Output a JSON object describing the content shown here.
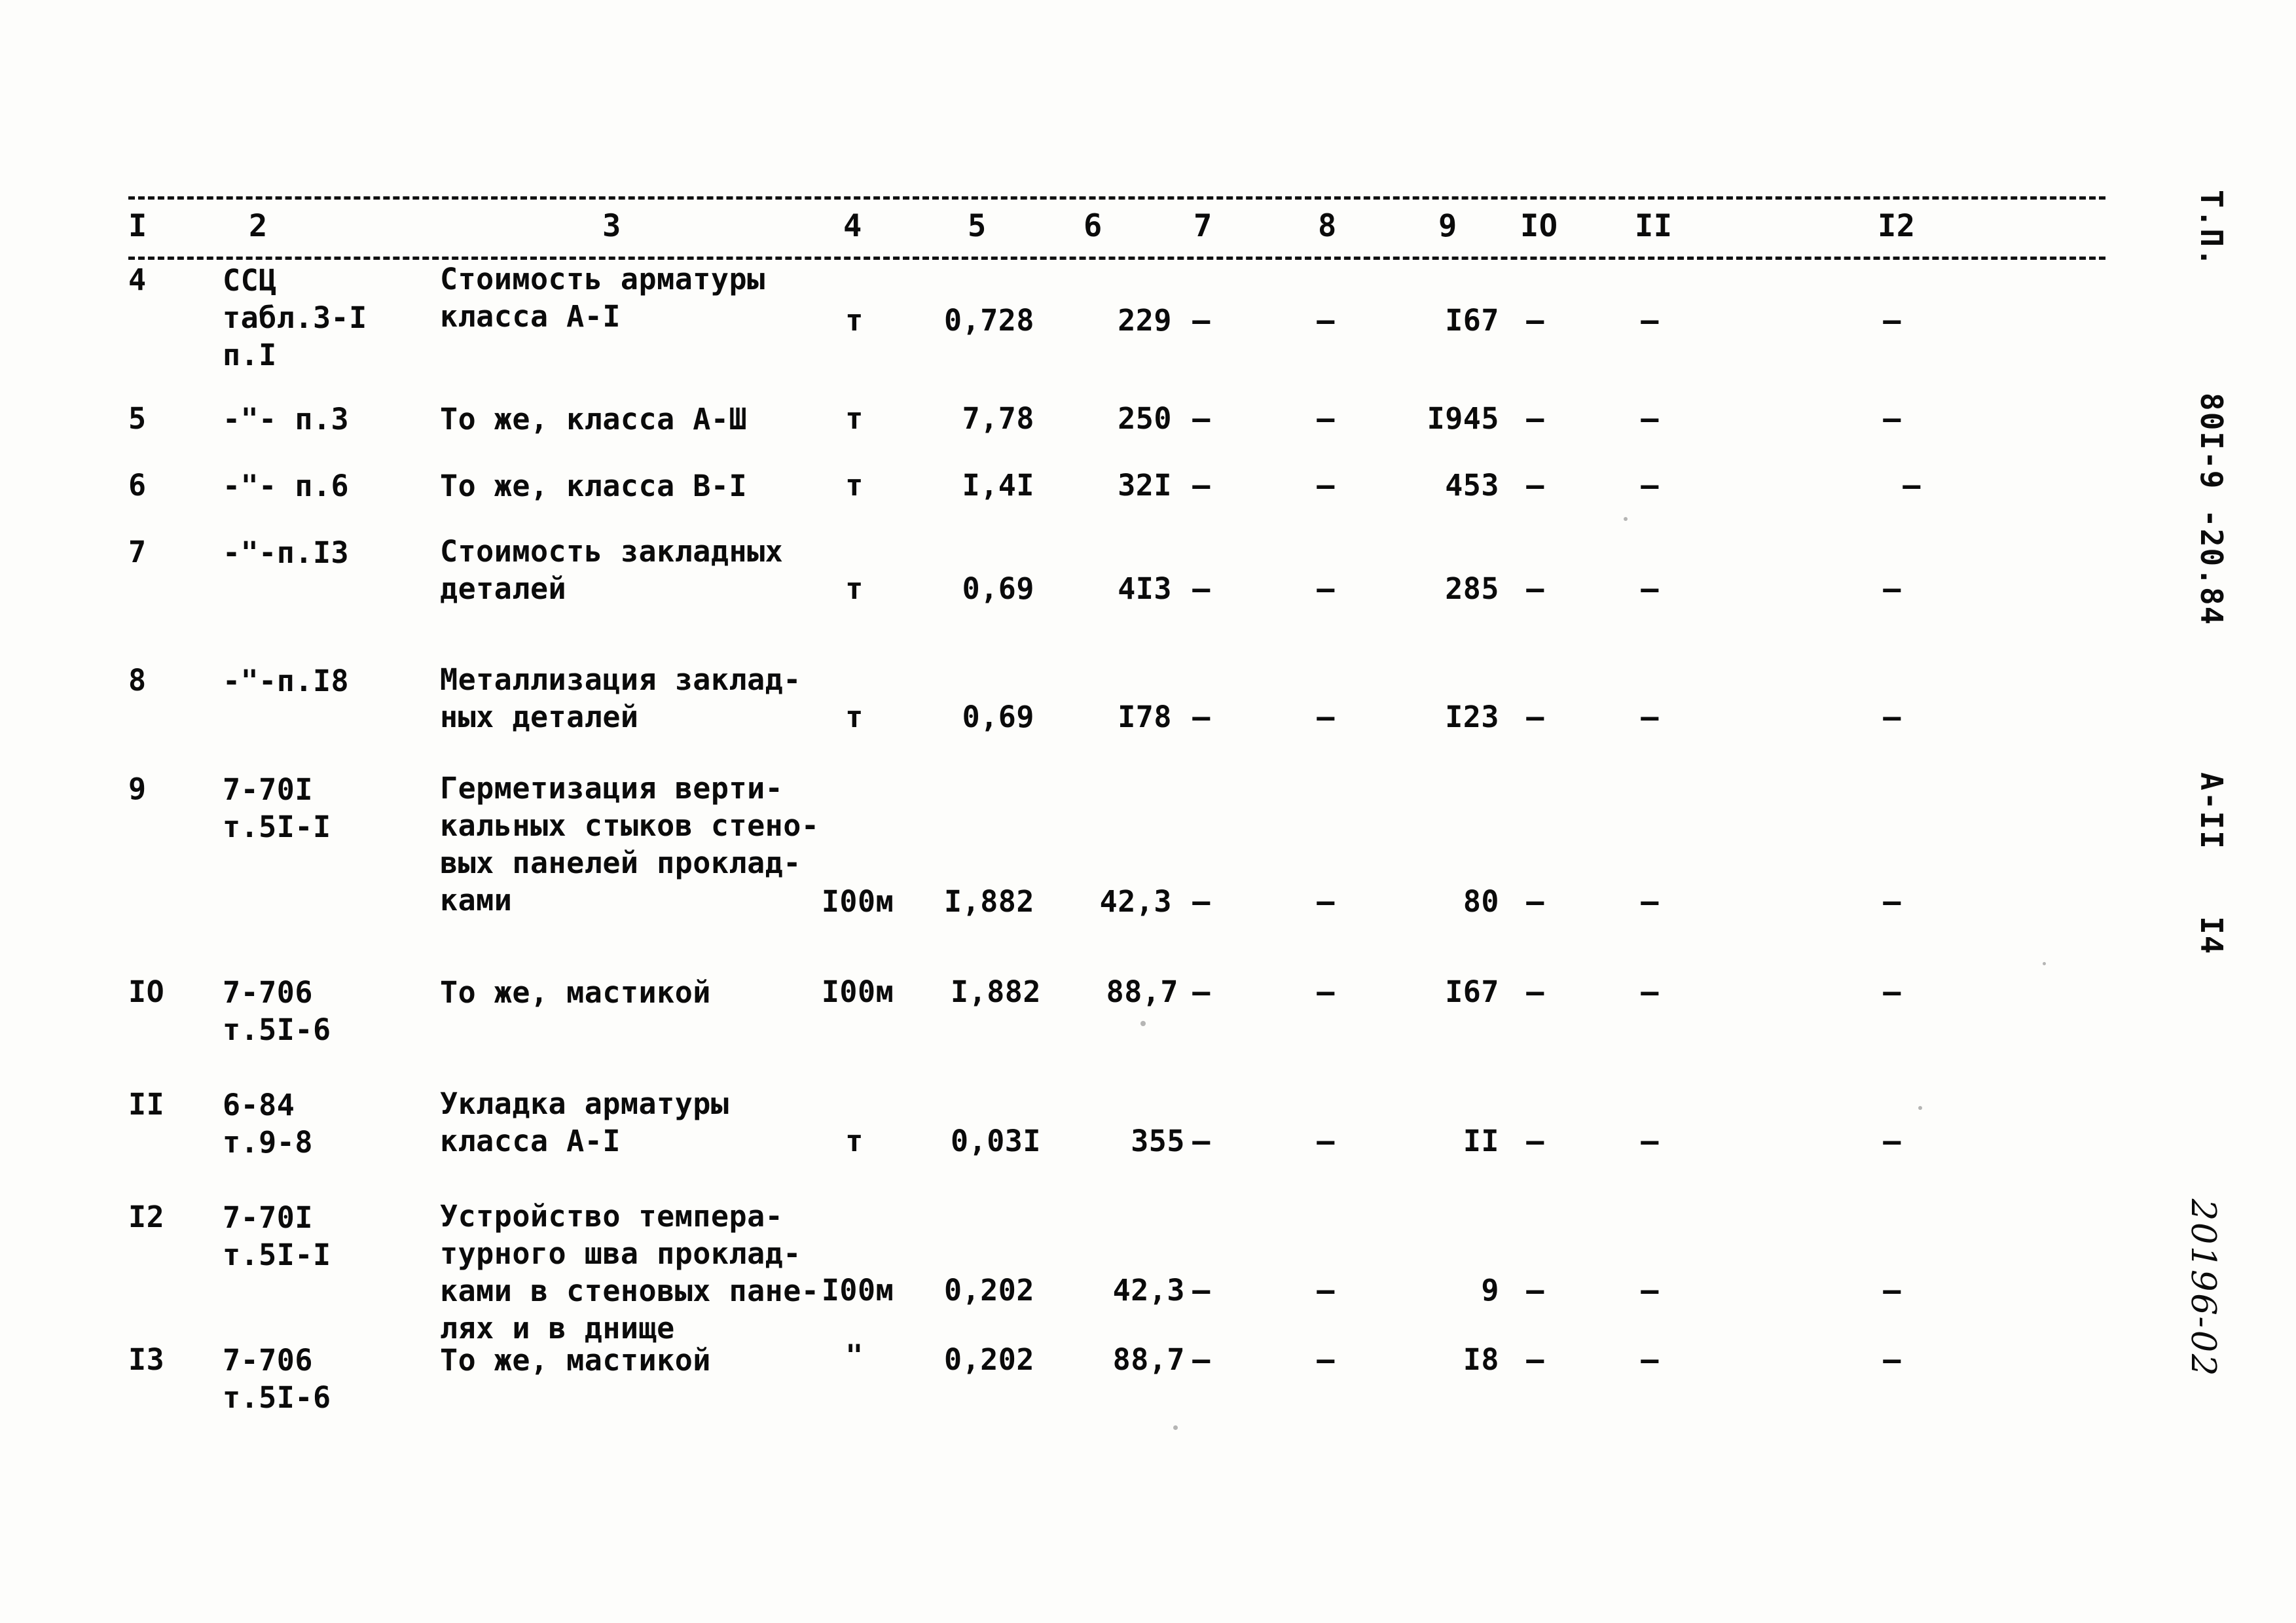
{
  "document": {
    "kind": "scanned-soviet-construction-estimate-table",
    "column_headers": [
      "I",
      "2",
      "3",
      "4",
      "5",
      "6",
      "7",
      "8",
      "9",
      "IO",
      "II",
      "I2"
    ]
  },
  "margin": {
    "stamp_tp": "Т.П.",
    "stamp_code": "80I-9 -20.84",
    "stamp_sheet": "А-II",
    "stamp_page": "I4",
    "stamp_handwritten": "20196-02"
  },
  "rows": [
    {
      "c1": "4",
      "c2": "ССЦ\nтабл.3-I\nп.I",
      "c3": "Стоимость арматуры\nкласса А-I",
      "c4": "т",
      "c5": "0,728",
      "c6": "229",
      "c7": "–",
      "c8": "–",
      "c9": "I67",
      "c10": "–",
      "c11": "–",
      "c12": "–"
    },
    {
      "c1": "5",
      "c2": "-\"- п.3",
      "c3": "То же,  класса А-Ш",
      "c4": "т",
      "c5": "7,78",
      "c6": "250",
      "c7": "–",
      "c8": "–",
      "c9": "I945",
      "c10": "–",
      "c11": "–",
      "c12": "–"
    },
    {
      "c1": "6",
      "c2": "-\"- п.6",
      "c3": "То же,  класса В-I",
      "c4": "т",
      "c5": "I,4I",
      "c6": "32I",
      "c7": "–",
      "c8": "–",
      "c9": "453",
      "c10": "–",
      "c11": "–",
      "c12": "–"
    },
    {
      "c1": "7",
      "c2": "-\"-п.I3",
      "c3": "Стоимость закладных\nдеталей",
      "c4": "т",
      "c5": "0,69",
      "c6": "4I3",
      "c7": "–",
      "c8": "–",
      "c9": "285",
      "c10": "–",
      "c11": "–",
      "c12": "–"
    },
    {
      "c1": "8",
      "c2": "-\"-п.I8",
      "c3": "Металлизация заклад-\nных  деталей",
      "c4": "т",
      "c5": "0,69",
      "c6": "I78",
      "c7": "–",
      "c8": "–",
      "c9": "I23",
      "c10": "–",
      "c11": "–",
      "c12": "–"
    },
    {
      "c1": "9",
      "c2": "7-70I\nт.5I-I",
      "c3": "Герметизация верти-\nкальных стыков стено-\nвых панелей проклад-\nками",
      "c4": "I00м",
      "c5": "I,882",
      "c6": "42,3",
      "c7": "–",
      "c8": "–",
      "c9": "80",
      "c10": "–",
      "c11": "–",
      "c12": "–"
    },
    {
      "c1": "IO",
      "c2": "7-706\nт.5I-6",
      "c3": "То же,  мастикой",
      "c4": "I00м",
      "c5": "I,882",
      "c6": "88,7",
      "c7": "–",
      "c8": "–",
      "c9": "I67",
      "c10": "–",
      "c11": "–",
      "c12": "–"
    },
    {
      "c1": "II",
      "c2": "6-84\nт.9-8",
      "c3": "Укладка арматуры\nкласса А-I",
      "c4": "т",
      "c5": "0,03I",
      "c6": "355",
      "c7": "–",
      "c8": "–",
      "c9": "II",
      "c10": "–",
      "c11": "–",
      "c12": "–"
    },
    {
      "c1": "I2",
      "c2": "7-70I\nт.5I-I",
      "c3": "Устройство темпера-\nтурного шва проклад-\nками в стеновых пане-\nлях  и в днище",
      "c4": "I00м",
      "c5": "0,202",
      "c6": "42,3",
      "c7": "–",
      "c8": "–",
      "c9": "9",
      "c10": "–",
      "c11": "–",
      "c12": "–"
    },
    {
      "c1": "I3",
      "c2": "7-706\nт.5I-6",
      "c3": "То же,  мастикой",
      "c4": "\"",
      "c5": "0,202",
      "c6": "88,7",
      "c7": "–",
      "c8": "–",
      "c9": "I8",
      "c10": "–",
      "c11": "–",
      "c12": "–"
    }
  ]
}
